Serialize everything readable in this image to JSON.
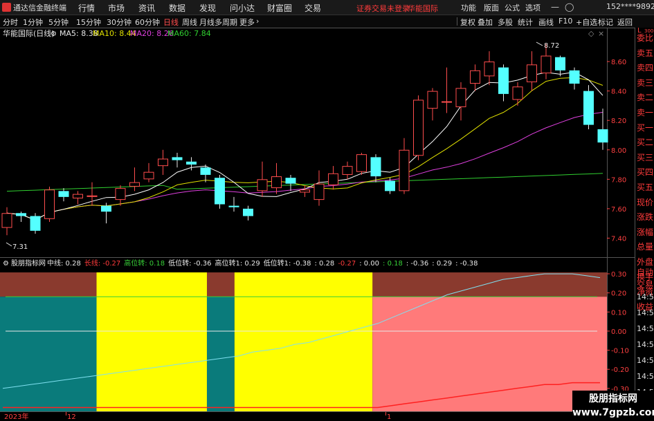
{
  "app": {
    "title": "通达信金融终端"
  },
  "menu": {
    "items": [
      "行情",
      "市场",
      "资讯",
      "数据",
      "发现",
      "问小达",
      "财富圈",
      "交易"
    ],
    "notice": "证券交易未登录",
    "stock_link": "华能国际",
    "right_items": [
      "功能",
      "版面",
      "公式",
      "选项"
    ],
    "user": "152****9892"
  },
  "toolbar": {
    "periods": [
      "分时",
      "1分钟",
      "5分钟",
      "15分钟",
      "30分钟",
      "60分钟",
      "日线",
      "周线",
      "月线",
      "多周期",
      "更多"
    ],
    "active_period": "日线",
    "tools": [
      "复权",
      "叠加",
      "多股",
      "统计",
      "画线",
      "F10",
      "+自选",
      "标记",
      "返回"
    ]
  },
  "chart_header": {
    "name": "华能国际(日线)",
    "ma5": "MA5: 8.38",
    "ma10": "MA10: 8.44",
    "ma20": "MA20: 8.26",
    "ma60": "MA60: 7.84"
  },
  "annotations": {
    "high": "8.72",
    "low": "7.31"
  },
  "indicator_header": {
    "name": "股朋指标网",
    "items": [
      {
        "text": "中线: 0.28",
        "color": "#e8e8e8"
      },
      {
        "text": "长线: -0.27",
        "color": "#ff3b3b"
      },
      {
        "text": "高位转: 0.18",
        "color": "#37d037"
      },
      {
        "text": "低位转: -0.36",
        "color": "#e8e8e8"
      },
      {
        "text": "高位转1: 0.29",
        "color": "#e8e8e8"
      },
      {
        "text": "低位转1: -0.38",
        "color": "#e8e8e8"
      },
      {
        "text": ": 0.28",
        "color": "#e8e8e8"
      },
      {
        "text": "-0.27",
        "color": "#ff3b3b"
      },
      {
        "text": ": 0.00",
        "color": "#e8e8e8"
      },
      {
        "text": ": 0.18",
        "color": "#37d037"
      },
      {
        "text": ": -0.36",
        "color": "#e8e8e8"
      },
      {
        "text": ": 0.29",
        "color": "#e8e8e8"
      },
      {
        "text": ": -0.38",
        "color": "#e8e8e8"
      }
    ]
  },
  "right_panel": {
    "corner": "L",
    "corner_sub": "300",
    "items": [
      "委比",
      "卖五",
      "卖四",
      "卖三",
      "卖二",
      "卖一",
      "买一",
      "买二",
      "买三",
      "买四",
      "买五",
      "现价",
      "涨跌",
      "涨幅",
      "总量",
      "外盘",
      "换手",
      "净资",
      "收益"
    ],
    "bottom_items": [
      "自动",
      "交易"
    ],
    "times": [
      "14:56",
      "14:56",
      "14:56",
      "14:56",
      "14:56",
      "14:56",
      "14:56",
      "14:56"
    ]
  },
  "x_labels": [
    "2023年",
    "12",
    "1"
  ],
  "watermark": {
    "line1": "股朋指标网",
    "line2": "www.7gpzb.com"
  },
  "colors": {
    "up": "#ff4d4d",
    "down": "#54ffff",
    "ma5": "#ffffff",
    "ma10": "#e0e000",
    "ma20": "#e040e0",
    "ma60": "#30d030"
  },
  "chart_data": [
    {
      "type": "candlestick",
      "title": "华能国际(日线)",
      "y_ticks": [
        7.4,
        7.6,
        7.8,
        8.0,
        8.2,
        8.4,
        8.6
      ],
      "ylim": [
        7.28,
        8.76
      ],
      "candles": [
        [
          7.47,
          7.57,
          7.42,
          7.61
        ],
        [
          7.57,
          7.55,
          7.51,
          7.58
        ],
        [
          7.55,
          7.45,
          7.43,
          7.57
        ],
        [
          7.53,
          7.73,
          7.51,
          7.75
        ],
        [
          7.72,
          7.68,
          7.65,
          7.74
        ],
        [
          7.67,
          7.7,
          7.63,
          7.72
        ],
        [
          7.68,
          7.69,
          7.62,
          7.78
        ],
        [
          7.62,
          7.58,
          7.5,
          7.64
        ],
        [
          7.66,
          7.74,
          7.62,
          7.76
        ],
        [
          7.75,
          7.78,
          7.72,
          7.88
        ],
        [
          7.8,
          7.85,
          7.78,
          7.91
        ],
        [
          7.89,
          7.94,
          7.83,
          8.0
        ],
        [
          7.95,
          7.93,
          7.88,
          7.98
        ],
        [
          7.92,
          7.9,
          7.86,
          7.95
        ],
        [
          7.88,
          7.83,
          7.78,
          7.9
        ],
        [
          7.81,
          7.63,
          7.6,
          7.83
        ],
        [
          7.62,
          7.61,
          7.58,
          7.68
        ],
        [
          7.6,
          7.55,
          7.52,
          7.62
        ],
        [
          7.72,
          7.8,
          7.68,
          7.92
        ],
        [
          7.74,
          7.82,
          7.7,
          7.91
        ],
        [
          7.81,
          7.77,
          7.72,
          7.83
        ],
        [
          7.71,
          7.73,
          7.68,
          7.76
        ],
        [
          7.66,
          7.77,
          7.62,
          7.86
        ],
        [
          7.76,
          7.84,
          7.73,
          7.89
        ],
        [
          7.83,
          7.89,
          7.8,
          7.92
        ],
        [
          7.85,
          7.97,
          7.83,
          7.98
        ],
        [
          7.95,
          7.82,
          7.78,
          7.97
        ],
        [
          7.79,
          7.72,
          7.7,
          7.81
        ],
        [
          7.72,
          8.0,
          7.7,
          8.08
        ],
        [
          7.96,
          8.34,
          7.93,
          8.37
        ],
        [
          8.28,
          8.4,
          8.2,
          8.42
        ],
        [
          8.33,
          8.33,
          8.25,
          8.56
        ],
        [
          8.29,
          8.42,
          8.2,
          8.46
        ],
        [
          8.45,
          8.54,
          8.4,
          8.58
        ],
        [
          8.5,
          8.6,
          8.44,
          8.67
        ],
        [
          8.56,
          8.38,
          8.33,
          8.58
        ],
        [
          8.34,
          8.43,
          8.3,
          8.46
        ],
        [
          8.46,
          8.58,
          8.4,
          8.67
        ],
        [
          8.52,
          8.64,
          8.48,
          8.72
        ],
        [
          8.63,
          8.54,
          8.5,
          8.64
        ],
        [
          8.54,
          8.45,
          8.41,
          8.56
        ],
        [
          8.4,
          8.17,
          8.14,
          8.44
        ],
        [
          8.14,
          8.05,
          8.0,
          8.28
        ]
      ]
    },
    {
      "type": "line",
      "title": "股朋指标网",
      "y_ticks": [
        0.3,
        0.2,
        0.1,
        0.0,
        -0.1,
        -0.2,
        -0.3
      ],
      "ylim": [
        -0.42,
        0.34
      ],
      "series": [
        {
          "name": "中线",
          "values": [
            -0.3,
            -0.29,
            -0.28,
            -0.27,
            -0.26,
            -0.25,
            -0.24,
            -0.23,
            -0.22,
            -0.21,
            -0.2,
            -0.19,
            -0.18,
            -0.17,
            -0.16,
            -0.15,
            -0.14,
            -0.13,
            -0.11,
            -0.1,
            -0.09,
            -0.07,
            -0.06,
            -0.04,
            -0.02,
            0.0,
            0.02,
            0.04,
            0.07,
            0.1,
            0.13,
            0.16,
            0.19,
            0.21,
            0.23,
            0.25,
            0.27,
            0.28,
            0.29,
            0.3,
            0.3,
            0.3,
            0.29,
            0.28
          ]
        },
        {
          "name": "长线",
          "values": [
            -0.4,
            -0.4,
            -0.4,
            -0.4,
            -0.4,
            -0.4,
            -0.4,
            -0.4,
            -0.4,
            -0.4,
            -0.4,
            -0.4,
            -0.4,
            -0.4,
            -0.4,
            -0.4,
            -0.4,
            -0.4,
            -0.4,
            -0.4,
            -0.4,
            -0.4,
            -0.4,
            -0.4,
            -0.4,
            -0.4,
            -0.4,
            -0.4,
            -0.39,
            -0.38,
            -0.37,
            -0.36,
            -0.35,
            -0.34,
            -0.33,
            -0.32,
            -0.31,
            -0.3,
            -0.29,
            -0.28,
            -0.28,
            -0.27,
            -0.27,
            -0.27
          ]
        },
        {
          "name": "高位转",
          "values": [
            0.18
          ]
        },
        {
          "name": "低位转",
          "values": [
            0.0
          ]
        }
      ],
      "zones": [
        "teal",
        "yellow",
        "teal",
        "yellow",
        "salmon"
      ],
      "zone_bounds": [
        0,
        7,
        15,
        17,
        27,
        44
      ]
    }
  ]
}
